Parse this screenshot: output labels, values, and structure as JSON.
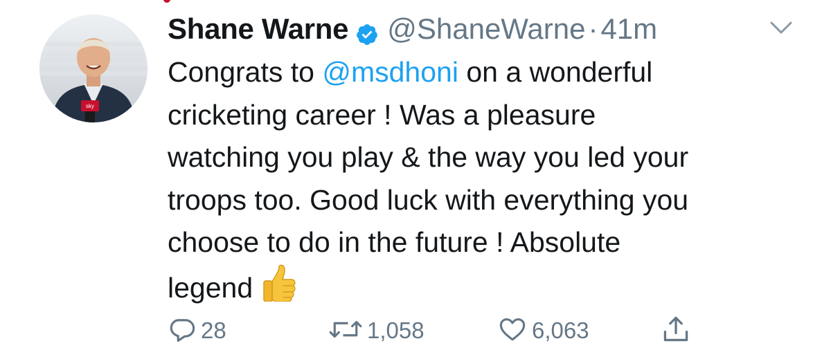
{
  "tweet": {
    "author": {
      "display_name": "Shane Warne",
      "handle": "@ShaneWarne",
      "verified": true
    },
    "separator": "·",
    "timestamp": "41m",
    "text_lines": [
      [
        "Congrats to ",
        "@msdhoni",
        " on a wonderful"
      ],
      [
        "cricketing career ! Was a pleasure"
      ],
      [
        "watching you play & the way you led your"
      ],
      [
        "troops too. Good luck with everything you"
      ],
      [
        "choose to do in the future ! Absolute"
      ],
      [
        "legend"
      ]
    ],
    "emoji": "thumbs-up",
    "avatar_badge": "sky"
  },
  "actions": {
    "reply_count": "28",
    "retweet_count": "1,058",
    "like_count": "6,063"
  },
  "icons": {
    "verified": "verified-badge-icon",
    "more": "chevron-down-icon",
    "reply": "reply-icon",
    "retweet": "retweet-icon",
    "like": "heart-icon",
    "share": "share-icon"
  },
  "colors": {
    "text": "#14171a",
    "secondary": "#657786",
    "link": "#1da1f2",
    "verified": "#1da1f2",
    "background": "#ffffff"
  }
}
